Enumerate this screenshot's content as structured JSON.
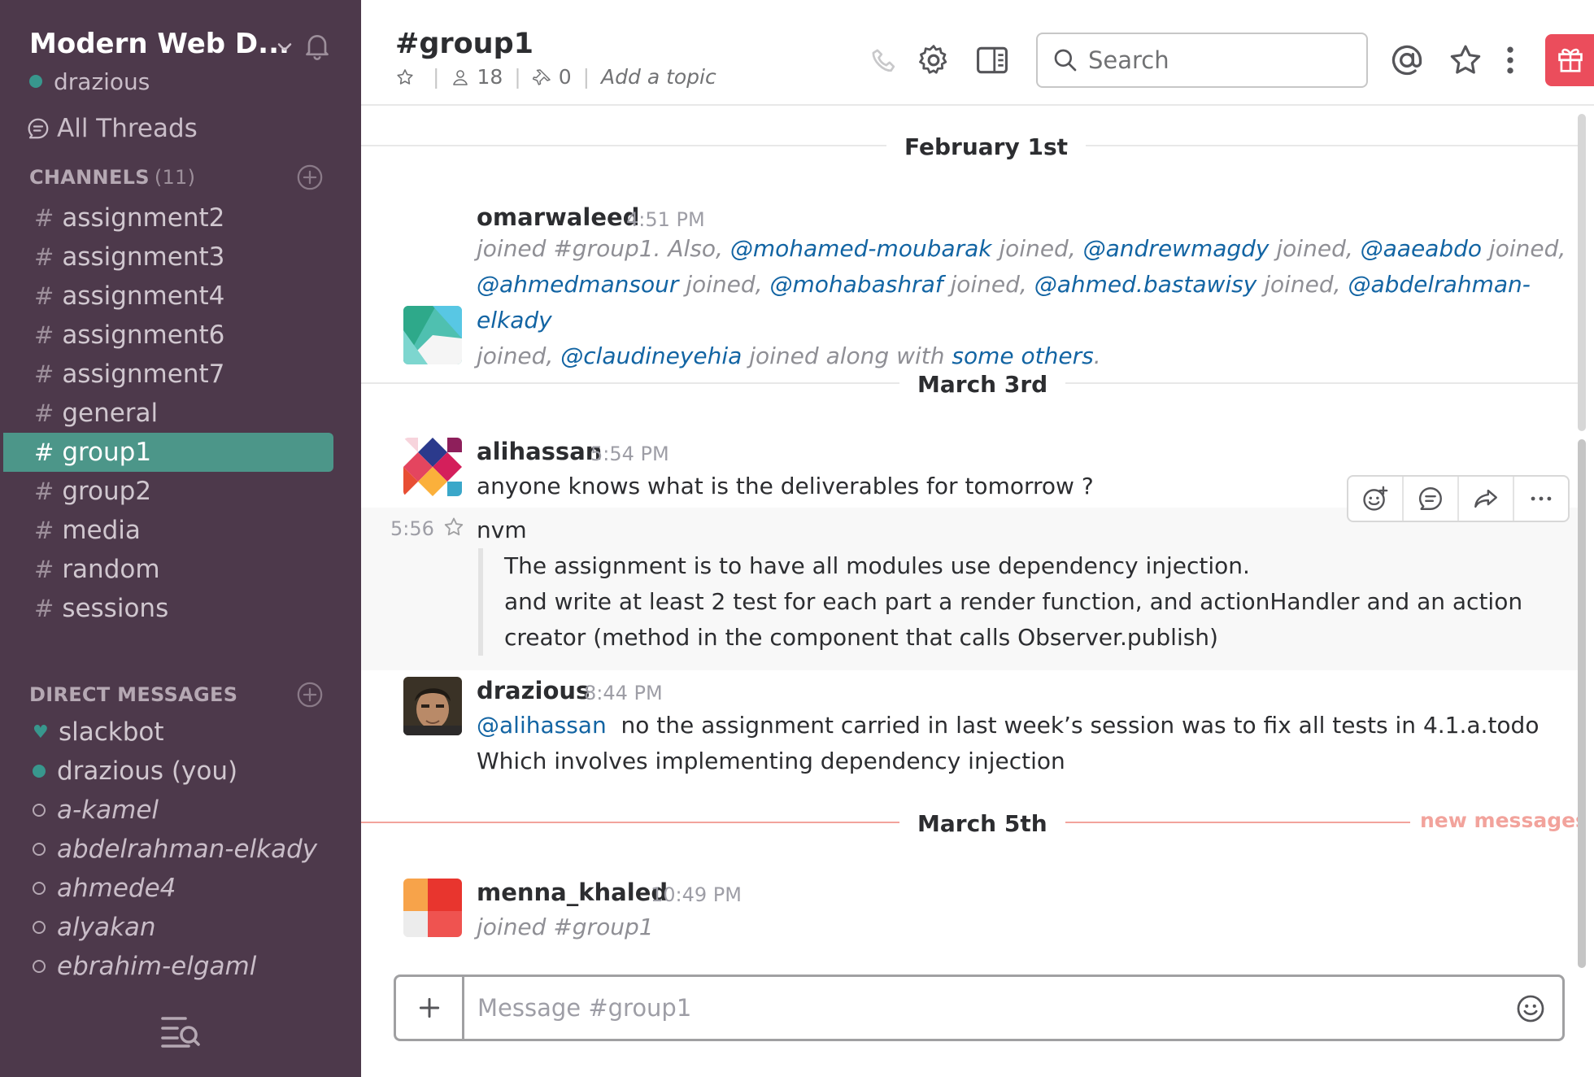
{
  "sidebar": {
    "team_name": "Modern Web D...",
    "user_name": "drazious",
    "all_threads": "All Threads",
    "channels_heading": "CHANNELS",
    "channels_count": "(11)",
    "channels": [
      {
        "name": "assignment2"
      },
      {
        "name": "assignment3"
      },
      {
        "name": "assignment4"
      },
      {
        "name": "assignment6"
      },
      {
        "name": "assignment7"
      },
      {
        "name": "general"
      },
      {
        "name": "group1",
        "active": true
      },
      {
        "name": "group2"
      },
      {
        "name": "media"
      },
      {
        "name": "random"
      },
      {
        "name": "sessions"
      }
    ],
    "dm_heading": "DIRECT MESSAGES",
    "direct_messages": [
      {
        "name": "slackbot",
        "status": "bot"
      },
      {
        "name": "drazious (you)",
        "status": "online"
      },
      {
        "name": "a-kamel",
        "status": "away"
      },
      {
        "name": "abdelrahman-elkady",
        "status": "away"
      },
      {
        "name": "ahmede4",
        "status": "away"
      },
      {
        "name": "alyakan",
        "status": "away"
      },
      {
        "name": "ebrahim-elgaml",
        "status": "away"
      }
    ],
    "colors": {
      "background": "#4d394b",
      "active": "#4c9689",
      "presence": "#38978d"
    }
  },
  "header": {
    "channel_title": "#group1",
    "member_count": "18",
    "pinned_count": "0",
    "topic_placeholder": "Add a topic",
    "search_placeholder": "Search",
    "icons": [
      "star-icon",
      "member-icon",
      "pin-icon",
      "phone-icon",
      "gear-icon",
      "sidebar-toggle-icon",
      "search-icon",
      "mention-icon",
      "star-icon",
      "more-vertical-icon",
      "gift-icon"
    ]
  },
  "messages": {
    "day1": "February 1st",
    "day2": "March 3rd",
    "day3": "March 5th",
    "new_messages": "new messages",
    "m1": {
      "author": "omarwaleed",
      "time": "4:51 PM",
      "l1_a": "joined #group1. Also, ",
      "l1_m1": "@mohamed-moubarak",
      "l1_b": " joined, ",
      "l1_m2": "@andrewmagdy",
      "l1_c": " joined, ",
      "l1_m3": "@aaeabdo",
      "l1_d": " joined,",
      "l2_m1": "@ahmedmansour",
      "l2_a": " joined, ",
      "l2_m2": "@mohabashraf",
      "l2_b": " joined, ",
      "l2_m3": "@ahmed.bastawisy",
      "l2_c": " joined, ",
      "l2_m4": "@abdelrahman-elkady",
      "l3_a": "joined, ",
      "l3_m1": "@claudineyehia",
      "l3_b": " joined along with ",
      "l3_link": "some others",
      "l3_c": "."
    },
    "m2": {
      "author": "alihassan",
      "time": "5:54 PM",
      "text": "anyone knows what is the deliverables for tomorrow ?"
    },
    "m3": {
      "time": "5:56",
      "text": "nvm",
      "quote_l1": "The assignment is to have all modules use dependency injection.",
      "quote_l2": "and write at least 2 test for each part a render function, and actionHandler and an action",
      "quote_l3": "creator (method in the component that calls Observer.publish)"
    },
    "m4": {
      "author": "drazious",
      "time": "8:44 PM",
      "mention": "@alihassan",
      "l1": "  no the assignment carried in last week’s session was to fix all tests in 4.1.a.todo",
      "l2": "Which involves implementing dependency injection"
    },
    "m5": {
      "author": "menna_khaled",
      "time": "10:49 PM",
      "text": "joined #group1"
    }
  },
  "composer": {
    "placeholder": "Message #group1"
  }
}
